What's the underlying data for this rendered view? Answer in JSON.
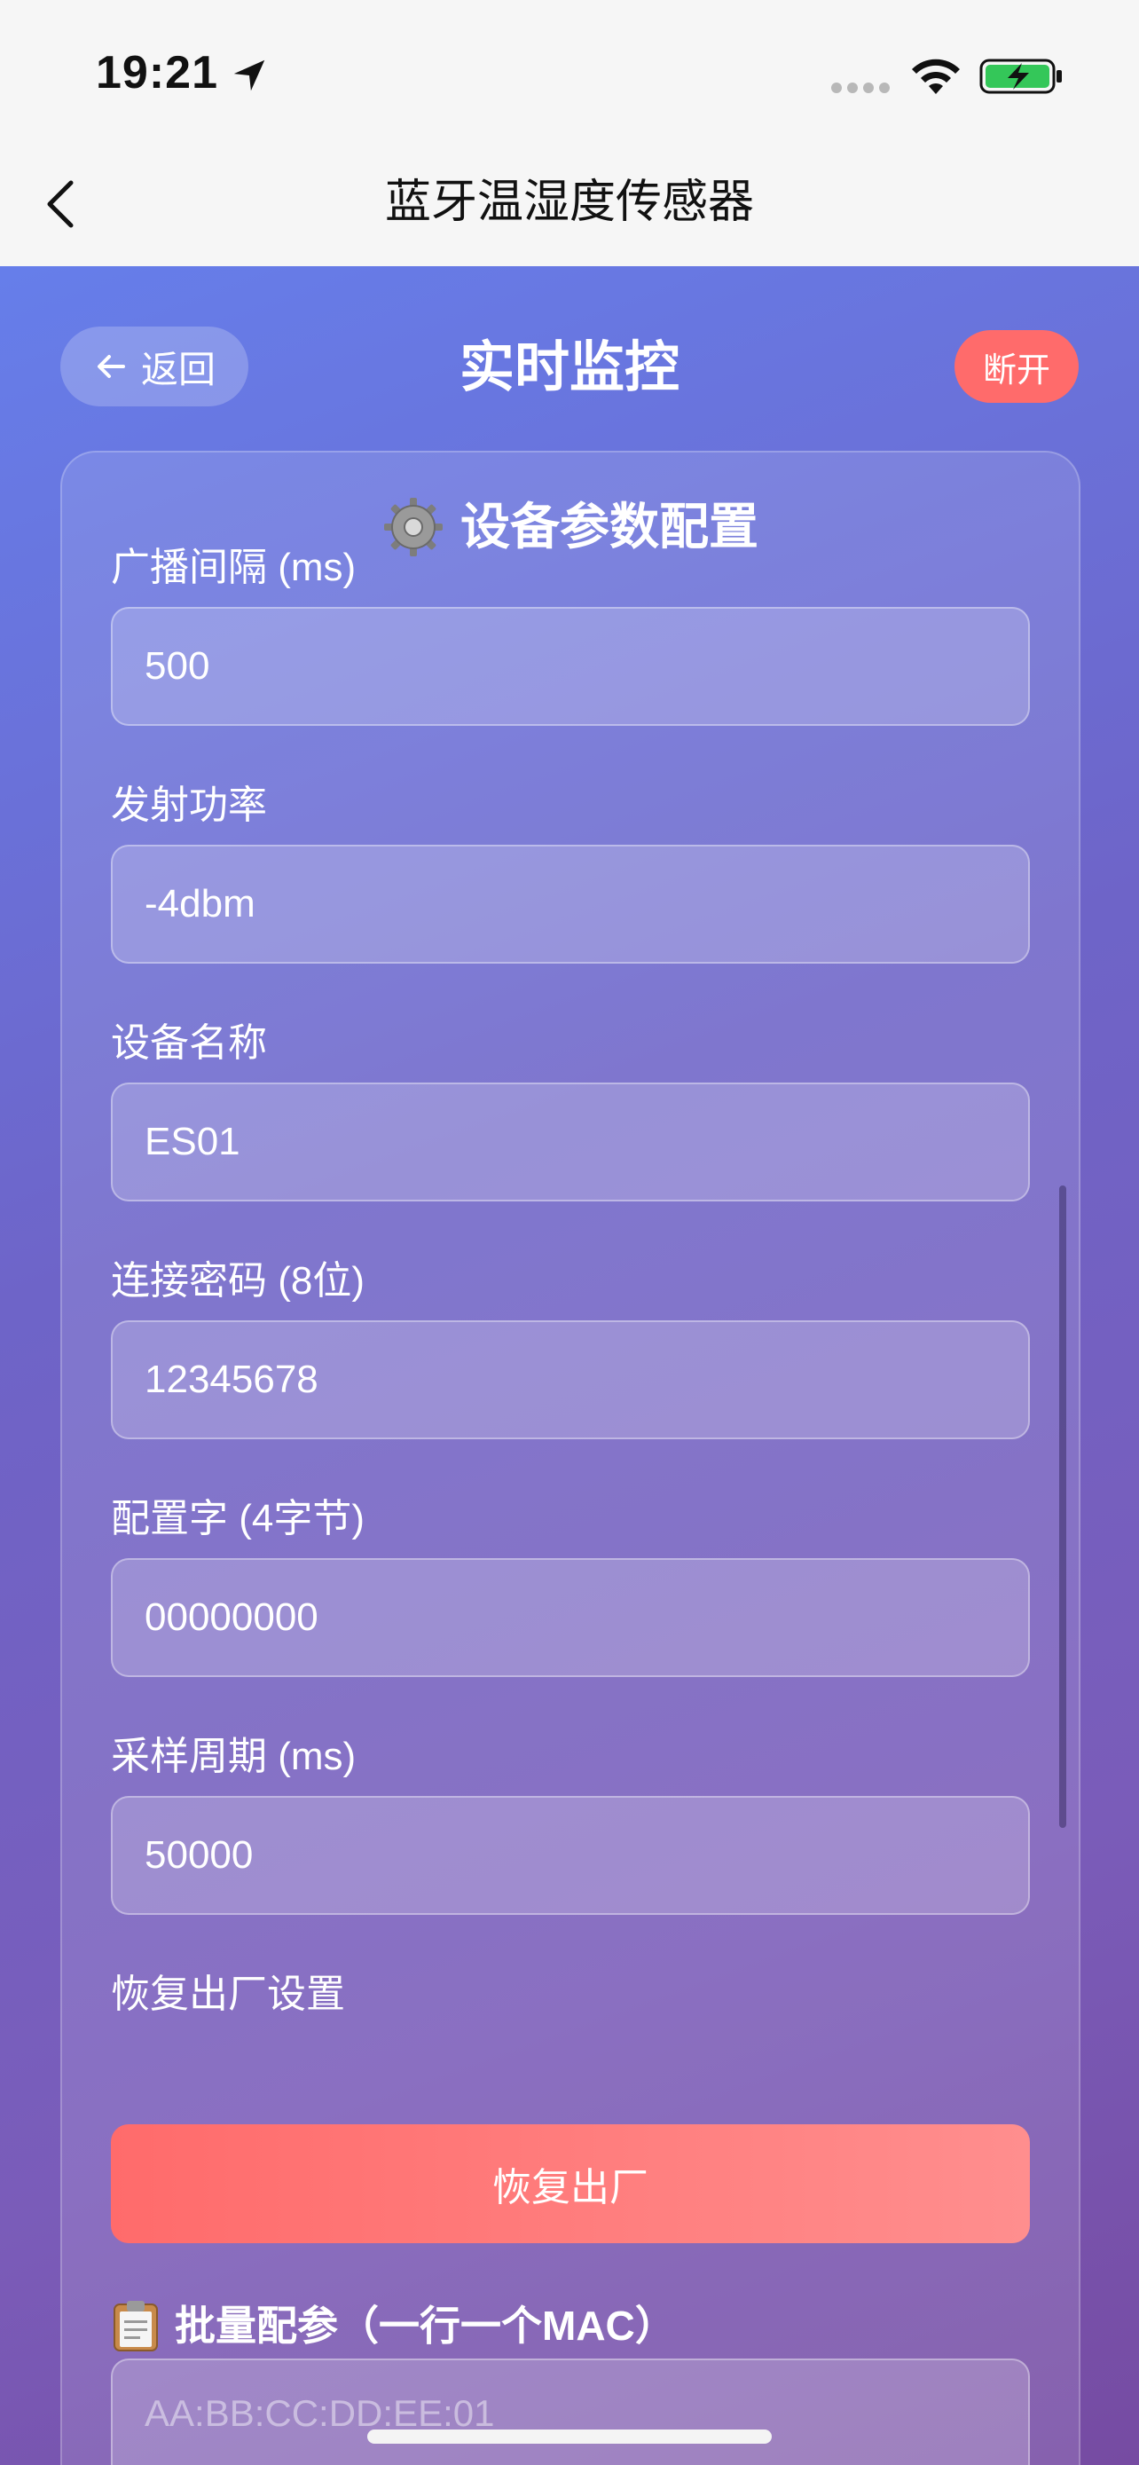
{
  "status_bar": {
    "time": "19:21"
  },
  "nav": {
    "title": "蓝牙温湿度传感器"
  },
  "header": {
    "back_label": "返回",
    "title": "实时监控",
    "disconnect_label": "断开"
  },
  "config": {
    "title": "设备参数配置",
    "fields": [
      {
        "label": "广播间隔 (ms)",
        "value": "500"
      },
      {
        "label": "发射功率",
        "value": "-4dbm"
      },
      {
        "label": "设备名称",
        "value": "ES01"
      },
      {
        "label": "连接密码 (8位)",
        "value": "12345678"
      },
      {
        "label": "配置字 (4字节)",
        "value": "00000000"
      },
      {
        "label": "采样周期 (ms)",
        "value": "50000"
      }
    ],
    "reset": {
      "label": "恢复出厂设置",
      "button": "恢复出厂"
    },
    "batch": {
      "title": "批量配参（一行一个MAC）",
      "placeholder": "AA:BB:CC:DD:EE:01"
    }
  },
  "colors": {
    "gradient_start": "#667eea",
    "gradient_end": "#764ba2",
    "danger": "#ff6b6b"
  },
  "icons": [
    "location-arrow-icon",
    "signal-dots-icon",
    "wifi-icon",
    "battery-charging-icon",
    "chevron-left-icon",
    "arrow-left-icon",
    "gear-icon",
    "clipboard-icon"
  ]
}
